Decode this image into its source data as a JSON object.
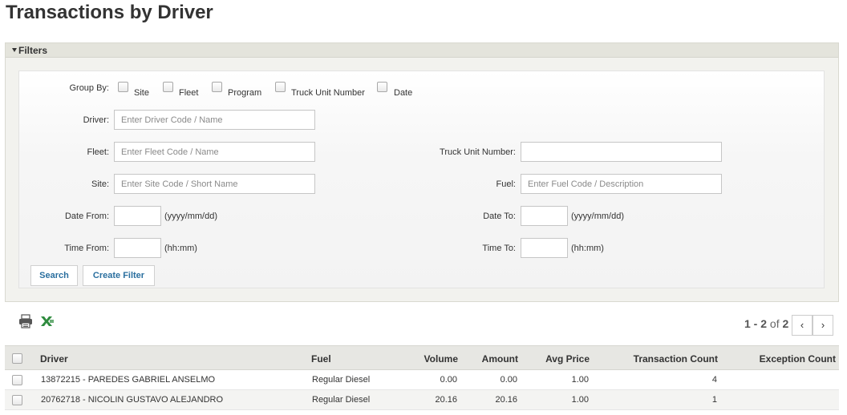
{
  "page": {
    "title": "Transactions by Driver"
  },
  "filters": {
    "header": "Filters",
    "group_by": {
      "label": "Group By:",
      "options": [
        "Site",
        "Fleet",
        "Program",
        "Truck Unit Number",
        "Date"
      ]
    },
    "driver": {
      "label": "Driver:",
      "placeholder": "Enter Driver Code / Name"
    },
    "fleet": {
      "label": "Fleet:",
      "placeholder": "Enter Fleet Code / Name"
    },
    "truck_unit_number": {
      "label": "Truck Unit Number:"
    },
    "site": {
      "label": "Site:",
      "placeholder": "Enter Site Code / Short Name"
    },
    "fuel": {
      "label": "Fuel:",
      "placeholder": "Enter Fuel Code / Description"
    },
    "date_from": {
      "label": "Date From:",
      "hint": "(yyyy/mm/dd)"
    },
    "date_to": {
      "label": "Date To:",
      "hint": "(yyyy/mm/dd)"
    },
    "time_from": {
      "label": "Time From:",
      "hint": "(hh:mm)"
    },
    "time_to": {
      "label": "Time To:",
      "hint": "(hh:mm)"
    },
    "search_button": "Search",
    "create_filter_button": "Create Filter"
  },
  "toolbar": {
    "print_icon": "printer-icon",
    "export_icon": "excel-export-icon"
  },
  "pager": {
    "range": "1 - 2",
    "of": "of",
    "total": "2",
    "prev": "‹",
    "next": "›"
  },
  "table": {
    "columns": [
      "Driver",
      "Fuel",
      "Volume",
      "Amount",
      "Avg Price",
      "Transaction Count",
      "Exception Count"
    ],
    "rows": [
      {
        "driver": "13872215 - PAREDES GABRIEL ANSELMO",
        "fuel": "Regular Diesel",
        "volume": "0.00",
        "amount": "0.00",
        "avg_price": "1.00",
        "transaction_count": "4",
        "exception_count": ""
      },
      {
        "driver": "20762718 - NICOLIN GUSTAVO ALEJANDRO",
        "fuel": "Regular Diesel",
        "volume": "20.16",
        "amount": "20.16",
        "avg_price": "1.00",
        "transaction_count": "1",
        "exception_count": ""
      }
    ]
  },
  "colors": {
    "link_blue": "#2a6f9f",
    "panel_bg": "#f2f2ee",
    "header_bg": "#e7e7e3"
  }
}
